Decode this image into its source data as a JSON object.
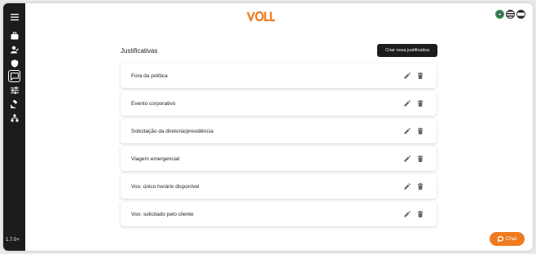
{
  "sidebar": {
    "items": [
      {
        "icon": "menu-icon"
      },
      {
        "icon": "briefcase-icon"
      },
      {
        "icon": "user-check-icon"
      },
      {
        "icon": "shield-icon"
      },
      {
        "icon": "comment-icon",
        "active": true
      },
      {
        "icon": "sliders-icon"
      },
      {
        "icon": "gavel-icon"
      },
      {
        "icon": "hierarchy-icon"
      }
    ],
    "version": "1.7.0+"
  },
  "header": {
    "logo_text": "VOLL",
    "brand_color": "#f07a1e",
    "flags": [
      "brazil-flag-icon",
      "us-flag-icon",
      "spain-flag-icon"
    ]
  },
  "main": {
    "title": "Justificativas",
    "new_button_label": "Criar nova justificativa",
    "rows": [
      {
        "label": "Fora da política"
      },
      {
        "label": "Evento corporativo"
      },
      {
        "label": "Solicitação da diretoria/presidência"
      },
      {
        "label": "Viagem emergencial"
      },
      {
        "label": "Voo: único horário disponível"
      },
      {
        "label": "Voo: solicitado pelo cliente"
      }
    ]
  },
  "chat": {
    "label": "Chat",
    "color": "#f07a1e"
  }
}
